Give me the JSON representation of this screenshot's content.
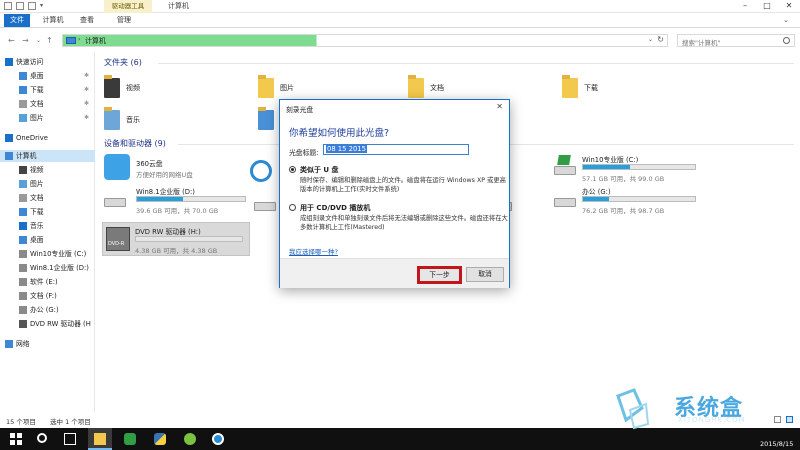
{
  "titlebar": {
    "context_tab": "驱动器工具",
    "title": "计算机",
    "minimize": "–",
    "maximize": "□",
    "close": "✕"
  },
  "ribbon": {
    "tabs": [
      "文件",
      "计算机",
      "查看",
      "管理"
    ]
  },
  "address": {
    "path": "计算机",
    "search_placeholder": "搜索\"计算机\""
  },
  "sidebar": {
    "items": [
      {
        "label": "快速访问",
        "icon": "star-icon"
      },
      {
        "label": "桌面",
        "icon": "desktop-icon",
        "pinned": true
      },
      {
        "label": "下载",
        "icon": "download-icon",
        "pinned": true
      },
      {
        "label": "文档",
        "icon": "document-icon",
        "pinned": true
      },
      {
        "label": "图片",
        "icon": "picture-icon",
        "pinned": true
      },
      {
        "label": "OneDrive",
        "icon": "cloud-icon"
      },
      {
        "label": "计算机",
        "icon": "computer-icon",
        "selected": true
      },
      {
        "label": "视频",
        "icon": "video-icon"
      },
      {
        "label": "图片",
        "icon": "picture-icon"
      },
      {
        "label": "文档",
        "icon": "document-icon"
      },
      {
        "label": "下载",
        "icon": "download-icon"
      },
      {
        "label": "音乐",
        "icon": "music-icon"
      },
      {
        "label": "桌面",
        "icon": "desktop-icon"
      },
      {
        "label": "Win10专业版 (C:)",
        "icon": "drive-icon"
      },
      {
        "label": "Win8.1企业版 (D:)",
        "icon": "drive-icon"
      },
      {
        "label": "软件 (E:)",
        "icon": "drive-icon"
      },
      {
        "label": "文档 (F:)",
        "icon": "drive-icon"
      },
      {
        "label": "办公 (G:)",
        "icon": "drive-icon"
      },
      {
        "label": "DVD RW 驱动器 (H",
        "icon": "dvd-icon"
      },
      {
        "label": "网络",
        "icon": "network-icon"
      }
    ]
  },
  "main": {
    "folders_header": "文件夹 (6)",
    "folders": [
      "视频",
      "图片",
      "文档",
      "下载",
      "音乐",
      "桌面"
    ],
    "drives_header": "设备和驱动器 (9)",
    "drives": [
      {
        "name": "360云盘",
        "sub": "方便好用的网络U盘"
      },
      {
        "name": "Win10专业版 (C:)",
        "free": "57.1 GB 可用，共 99.0 GB",
        "used": 0.42
      },
      {
        "name": "Win8.1企业版 (D:)",
        "free": "39.6 GB 可用，共 70.0 GB",
        "used": 0.43
      },
      {
        "name": "办公 (G:)",
        "free": "76.2 GB 可用，共 98.7 GB",
        "used": 0.23
      },
      {
        "name": "DVD RW 驱动器 (H:)",
        "free": "4.38 GB 可用，共 4.38 GB",
        "used": 0.0
      }
    ],
    "dvd_label": "DVD-R"
  },
  "status": {
    "count": "15 个项目",
    "selected": "选中 1 个项目"
  },
  "dialog": {
    "title": "刻录光盘",
    "close": "✕",
    "question": "你希望如何使用此光盘?",
    "disc_label": "光盘标题:",
    "disc_value": "08 15 2015",
    "opt1_title": "类似于 U 盘",
    "opt1_desc": "随时保存、编辑和删除磁盘上的文件。磁盘将在运行 Windows XP 或更高版本的计算机上工作(实时文件系统)",
    "opt2_title": "用于 CD/DVD 播放机",
    "opt2_desc": "成组刻录文件和单独刻录文件后将无法编辑或删除这些文件。磁盘还将在大多数计算机上工作(Mastered)",
    "help_link": "我应选择哪一种?",
    "next": "下一步",
    "cancel": "取消"
  },
  "watermark": {
    "brand": "系统盒",
    "url": "XITONGHE.COM"
  },
  "tray": {
    "date": "2015/8/15"
  }
}
